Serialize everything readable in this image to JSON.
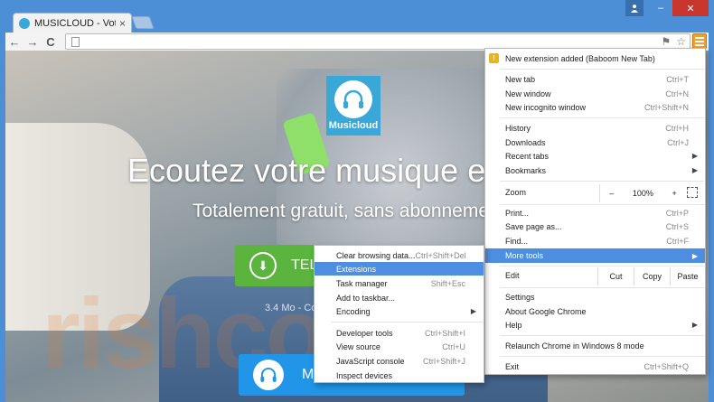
{
  "window": {
    "tab_title": "MUSICLOUD - Votre musi",
    "tab_close": "×",
    "user_icon": "user-icon",
    "minimize": "–",
    "close": "✕"
  },
  "toolbar": {
    "back": "←",
    "forward": "→",
    "reload": "C",
    "extension_icon": "⚑",
    "star": "☆"
  },
  "page": {
    "logo_text": "Musicloud",
    "headline": "Ecoutez votre musique e",
    "subline": "Totalement gratuit, sans abonneme",
    "download_label": "TEL",
    "size_note": "3.4 Mo - Cor",
    "music_label": "MU",
    "watermark": "rishcom"
  },
  "menu": {
    "notice": "New extension added (Baboom New Tab)",
    "new_tab": {
      "label": "New tab",
      "shortcut": "Ctrl+T"
    },
    "new_window": {
      "label": "New window",
      "shortcut": "Ctrl+N"
    },
    "new_incognito": {
      "label": "New incognito window",
      "shortcut": "Ctrl+Shift+N"
    },
    "history": {
      "label": "History",
      "shortcut": "Ctrl+H"
    },
    "downloads": {
      "label": "Downloads",
      "shortcut": "Ctrl+J"
    },
    "recent_tabs": {
      "label": "Recent tabs"
    },
    "bookmarks": {
      "label": "Bookmarks"
    },
    "zoom": {
      "label": "Zoom",
      "minus": "–",
      "value": "100%",
      "plus": "+"
    },
    "print": {
      "label": "Print...",
      "shortcut": "Ctrl+P"
    },
    "save_page": {
      "label": "Save page as...",
      "shortcut": "Ctrl+S"
    },
    "find": {
      "label": "Find...",
      "shortcut": "Ctrl+F"
    },
    "more_tools": {
      "label": "More tools"
    },
    "edit": {
      "label": "Edit",
      "cut": "Cut",
      "copy": "Copy",
      "paste": "Paste"
    },
    "settings": {
      "label": "Settings"
    },
    "about": {
      "label": "About Google Chrome"
    },
    "help": {
      "label": "Help"
    },
    "relaunch": {
      "label": "Relaunch Chrome in Windows 8 mode"
    },
    "exit": {
      "label": "Exit",
      "shortcut": "Ctrl+Shift+Q"
    }
  },
  "submenu": {
    "clear_data": {
      "label": "Clear browsing data...",
      "shortcut": "Ctrl+Shift+Del"
    },
    "extensions": {
      "label": "Extensions"
    },
    "task_manager": {
      "label": "Task manager",
      "shortcut": "Shift+Esc"
    },
    "add_taskbar": {
      "label": "Add to taskbar..."
    },
    "encoding": {
      "label": "Encoding"
    },
    "dev_tools": {
      "label": "Developer tools",
      "shortcut": "Ctrl+Shift+I"
    },
    "view_source": {
      "label": "View source",
      "shortcut": "Ctrl+U"
    },
    "js_console": {
      "label": "JavaScript console",
      "shortcut": "Ctrl+Shift+J"
    },
    "inspect_devices": {
      "label": "Inspect devices"
    }
  },
  "colors": {
    "frame": "#4d8fd6",
    "menu_highlight": "#4d8ee0",
    "download_button": "#5bb43e",
    "music_button": "#2196e8",
    "logo": "#39a8d8"
  }
}
